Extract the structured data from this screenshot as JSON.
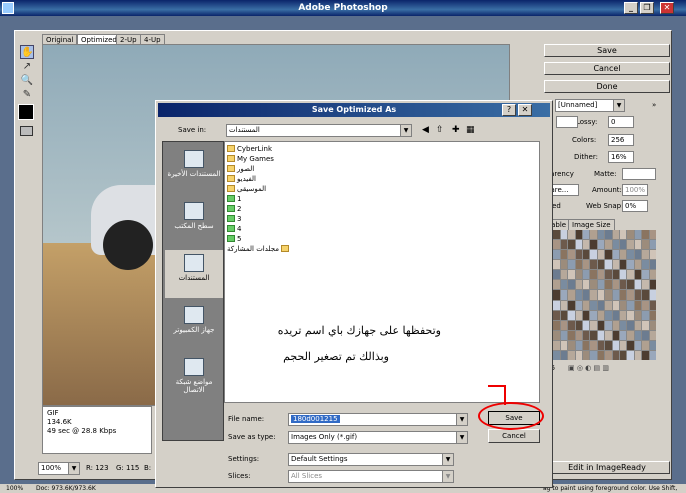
{
  "window": {
    "title": "Adobe Photoshop",
    "min": "_",
    "max": "❐",
    "close": "✕"
  },
  "tabs": [
    "Original",
    "Optimized",
    "2-Up",
    "4-Up"
  ],
  "info": {
    "format": "GIF",
    "size": "134.6K",
    "time": "49 sec @ 28.8 Kbps"
  },
  "status": {
    "zoom": "100%",
    "r": "R: 123",
    "g": "G: 115",
    "b": "B:"
  },
  "right": {
    "save": "Save",
    "cancel": "Cancel",
    "done": "Done",
    "preset": "[Unnamed]",
    "lossy_label": "Lossy:",
    "lossy_value": "0",
    "colors_label": "Colors:",
    "colors_value": "256",
    "dither_label": "Dither:",
    "dither_value": "16%",
    "transparency": "sparency",
    "matte_label": "Matte:",
    "pare": "pare...",
    "amount_label": "Amount:",
    "amount_value": "100%",
    "laced": "laced",
    "websnap_label": "Web Snap:",
    "websnap_value": "0%",
    "color_tab": "Table",
    "image_size_tab": "Image Size",
    "count": "56",
    "edit_ir": "Edit in ImageReady"
  },
  "bottom": {
    "zoom": "100%",
    "doc": "Doc: 973.6K/973.6K",
    "hint": "ag to paint using foreground color.  Use Shift,"
  },
  "dialog": {
    "title": "Save Optimized As",
    "help": "?",
    "close": "✕",
    "save_in_label": "Save in:",
    "save_in_value": "المستندات",
    "places": [
      "المستندات الأخيرة",
      "سطح المكتب",
      "المستندات",
      "جهاز الكمبيوتر",
      "مواضع شبكة الاتصال"
    ],
    "files": [
      "CyberLink",
      "My Games",
      "الصور",
      "الفيديو",
      "الموسيقى",
      "1",
      "2",
      "3",
      "4",
      "5",
      "مجلدات المشاركة"
    ],
    "note_line1": "وتحفظها على جهازك باي اسم تريده",
    "note_line2": "وبذالك تم تصغير الحجم",
    "filename_label": "File name:",
    "filename_value": "180d001215",
    "saveas_label": "Save as type:",
    "saveas_value": "Images Only (*.gif)",
    "settings_label": "Settings:",
    "settings_value": "Default Settings",
    "slices_label": "Slices:",
    "slices_value": "All Slices",
    "save_button": "Save",
    "cancel_button": "Cancel"
  },
  "colors": {
    "titlebar": "#0a246a",
    "annotation": "#ee0000",
    "face": "#d4d0c8"
  }
}
